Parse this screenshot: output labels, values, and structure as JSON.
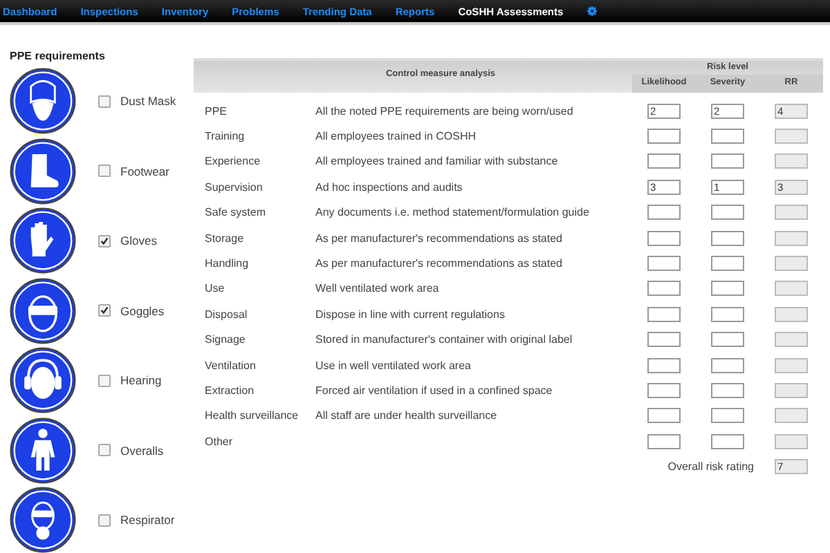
{
  "nav": [
    {
      "label": "Dashboard",
      "selected": false
    },
    {
      "label": "Inspections",
      "selected": false
    },
    {
      "label": "Inventory",
      "selected": false
    },
    {
      "label": "Problems",
      "selected": false
    },
    {
      "label": "Trending Data",
      "selected": false
    },
    {
      "label": "Reports",
      "selected": false
    },
    {
      "label": "CoSHH Assessments",
      "selected": true
    }
  ],
  "ppe": {
    "title": "PPE requirements",
    "items": [
      {
        "kind": "mask",
        "label": "Dust Mask",
        "checked": false
      },
      {
        "kind": "boot",
        "label": "Footwear",
        "checked": false
      },
      {
        "kind": "glove",
        "label": "Gloves",
        "checked": true
      },
      {
        "kind": "goggles",
        "label": "Goggles",
        "checked": true
      },
      {
        "kind": "ear",
        "label": "Hearing",
        "checked": false
      },
      {
        "kind": "overalls",
        "label": "Overalls",
        "checked": false
      },
      {
        "kind": "respirator",
        "label": "Respirator",
        "checked": false
      }
    ]
  },
  "table": {
    "title": "Control measure analysis",
    "group": "Risk level",
    "columns": [
      "Likelihood",
      "Severity",
      "RR"
    ],
    "rows": [
      {
        "name": "PPE",
        "description": "All the noted PPE requirements are being worn/used",
        "likelihood": "2",
        "severity": "2",
        "rr": "4"
      },
      {
        "name": "Training",
        "description": "All employees trained in COSHH"
      },
      {
        "name": "Experience",
        "description": "All employees trained and familiar with substance"
      },
      {
        "name": "Supervision",
        "description": "Ad hoc inspections and audits",
        "likelihood": "3",
        "severity": "1",
        "rr": "3"
      },
      {
        "name": "Safe system",
        "description": "Any documents i.e. method statement/formulation guide"
      },
      {
        "name": "Storage",
        "description": "As per manufacturer's recommendations as stated"
      },
      {
        "name": "Handling",
        "description": "As per manufacturer's recommendations as stated"
      },
      {
        "name": "Use",
        "description": "Well ventilated work area"
      },
      {
        "name": "Disposal",
        "description": "Dispose in line with current regulations"
      },
      {
        "name": "Signage",
        "description": "Stored in manufacturer's container with original label"
      },
      {
        "name": "Ventilation",
        "description": "Use in well ventilated work area"
      },
      {
        "name": "Extraction",
        "description": "Forced air ventilation if used in a confined space"
      },
      {
        "name": "Health surveillance",
        "description": "All staff are under health surveillance"
      },
      {
        "name": "Other"
      }
    ],
    "overall": {
      "label": "Overall risk rating",
      "value": "7"
    }
  }
}
